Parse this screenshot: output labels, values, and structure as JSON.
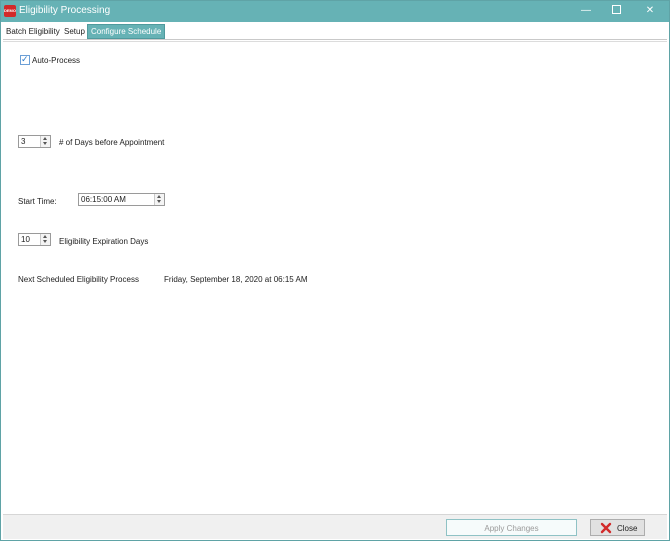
{
  "window": {
    "title": "Eligibility Processing",
    "app_icon_text": "DEMO",
    "controls": {
      "minimize": "—",
      "close": "✕"
    }
  },
  "tabs": [
    {
      "label": "Batch Eligibility"
    },
    {
      "label": "Setup"
    },
    {
      "label": "Configure Schedule",
      "active": true
    }
  ],
  "form": {
    "auto_process": {
      "label": "Auto-Process",
      "checked": true
    },
    "days_before": {
      "value": "3",
      "label": "# of Days before Appointment"
    },
    "start_time": {
      "label": "Start Time:",
      "value": "06:15:00 AM"
    },
    "expiration": {
      "value": "10",
      "label": "Eligibility Expiration Days"
    },
    "next_scheduled": {
      "label": "Next Scheduled Eligibility Process",
      "value": "Friday, September 18, 2020  at  06:15 AM"
    }
  },
  "footer": {
    "apply_label": "Apply Changes",
    "close_label": "Close"
  },
  "colors": {
    "titlebar": "#66b2b5",
    "active_tab": "#66b2b5",
    "close_icon": "#d22a2a"
  }
}
